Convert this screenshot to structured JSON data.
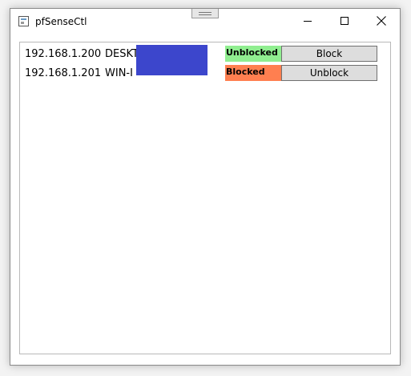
{
  "window": {
    "title": "pfSenseCtl"
  },
  "hosts": [
    {
      "ip": "192.168.1.200",
      "hostname": "DESKT",
      "status": "Unblocked",
      "status_color": "#90ee90",
      "action": "Block"
    },
    {
      "ip": "192.168.1.201",
      "hostname": "WIN-I",
      "status": "Blocked",
      "status_color": "#ff7f50",
      "action": "Unblock"
    }
  ],
  "colors": {
    "redaction": "#3c46cc",
    "button_bg": "#dddddd"
  }
}
